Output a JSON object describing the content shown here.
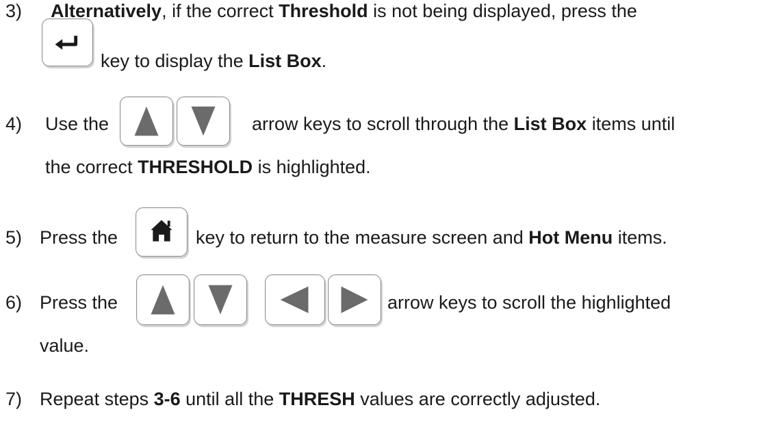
{
  "steps": [
    {
      "number": "3)",
      "lines": [
        [
          {
            "text": "Alternatively",
            "bold": true
          },
          {
            "text": ", if the correct ",
            "bold": false
          },
          {
            "text": "Threshold",
            "bold": true
          },
          {
            "text": " is not being displayed, press the",
            "bold": false
          }
        ],
        [
          {
            "text": "key to display the ",
            "bold": false
          },
          {
            "text": "List Box",
            "bold": true
          },
          {
            "text": ".",
            "bold": false
          }
        ]
      ],
      "keys": [
        "enter-icon"
      ]
    },
    {
      "number": "4)",
      "lines": [
        [
          {
            "text": "Use the",
            "bold": false
          },
          {
            "text": "arrow keys to scroll through the ",
            "bold": false
          },
          {
            "text": "List Box",
            "bold": true
          },
          {
            "text": " items until",
            "bold": false
          }
        ],
        [
          {
            "text": "the correct ",
            "bold": false
          },
          {
            "text": "THRESHOLD",
            "bold": true
          },
          {
            "text": " is highlighted.",
            "bold": false
          }
        ]
      ],
      "keys": [
        "up-arrow-icon",
        "down-arrow-icon"
      ]
    },
    {
      "number": "5)",
      "lines": [
        [
          {
            "text": "Press the",
            "bold": false
          },
          {
            "text": "key to return to the measure screen and ",
            "bold": false
          },
          {
            "text": "Hot Menu",
            "bold": true
          },
          {
            "text": " items.",
            "bold": false
          }
        ]
      ],
      "keys": [
        "home-icon"
      ]
    },
    {
      "number": "6)",
      "lines": [
        [
          {
            "text": "Press the",
            "bold": false
          },
          {
            "text": "arrow keys to scroll the highlighted",
            "bold": false
          }
        ],
        [
          {
            "text": "value.",
            "bold": false
          }
        ]
      ],
      "keys": [
        "up-arrow-icon",
        "down-arrow-icon",
        "left-arrow-icon",
        "right-arrow-icon"
      ]
    },
    {
      "number": "7)",
      "lines": [
        [
          {
            "text": "Repeat steps ",
            "bold": false
          },
          {
            "text": "3-6",
            "bold": true
          },
          {
            "text": " until all the ",
            "bold": false
          },
          {
            "text": "THRESH",
            "bold": true
          },
          {
            "text": " values are correctly adjusted.",
            "bold": false
          }
        ]
      ],
      "keys": []
    }
  ],
  "colors": {
    "text": "#1a1a1a",
    "key_border": "#8f8f8f",
    "key_glyph": "#6b6b6b",
    "key_shadow": "#d4d4d4"
  }
}
